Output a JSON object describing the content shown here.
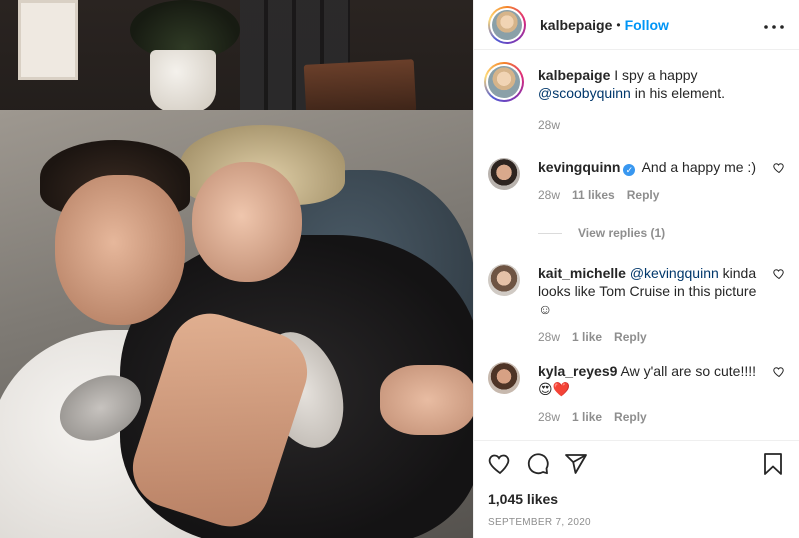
{
  "post": {
    "username": "kalbepaige",
    "follow_label": "Follow",
    "separator": "•",
    "more_label": "•••"
  },
  "caption": {
    "username": "kalbepaige",
    "text_before": "I spy a happy",
    "mention": "@scoobyquinn",
    "text_after": "in his element.",
    "time": "28w"
  },
  "comments": [
    {
      "username": "kevingquinn",
      "verified": true,
      "text": "And a happy me :)",
      "time": "28w",
      "likes": "11 likes",
      "reply": "Reply",
      "view_replies": "View replies (1)"
    },
    {
      "username": "kait_michelle",
      "mention": "@kevingquinn",
      "text": "kinda looks like Tom Cruise in this picture ☺",
      "time": "28w",
      "likes": "1 like",
      "reply": "Reply"
    },
    {
      "username": "kyla_reyes9",
      "text": "Aw y'all are so cute!!!! 😍❤️",
      "time": "28w",
      "likes": "1 like",
      "reply": "Reply"
    }
  ],
  "footer": {
    "likes": "1,045 likes",
    "date": "SEPTEMBER 7, 2020"
  },
  "icons": {
    "heart": "heart-icon",
    "comment": "comment-icon",
    "share": "share-icon",
    "bookmark": "bookmark-icon",
    "more": "more-icon"
  },
  "colors": {
    "link": "#0095f6",
    "mention": "#00376b",
    "secondary_text": "#8e8e8e",
    "verified": "#3897f0"
  }
}
